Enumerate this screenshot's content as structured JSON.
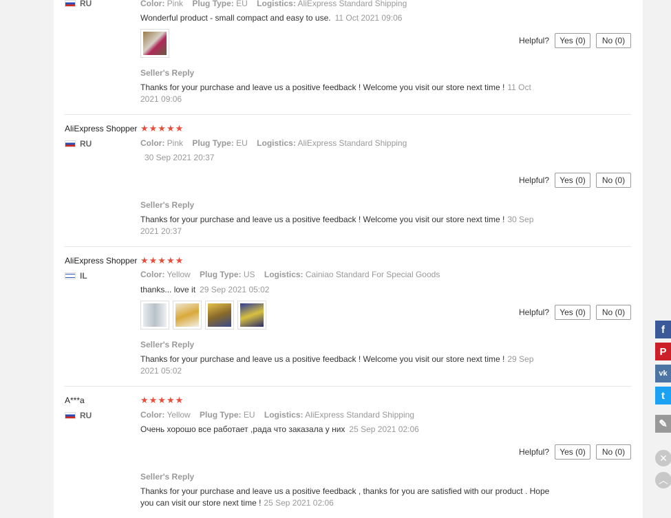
{
  "helpful_label": "Helpful?",
  "seller_reply_label": "Seller's Reply",
  "labels": {
    "color": "Color:",
    "plug": "Plug Type:",
    "logistics": "Logistics:"
  },
  "stars": "★★★★★",
  "reviews": [
    {
      "name": "",
      "country": "RU",
      "color": "Pink",
      "plug": "EU",
      "logistics": "AliExpress Standard Shipping",
      "text": "Wonderful product - small compact and easy to use.",
      "date": "11 Oct 2021 09:06",
      "yes": "Yes (0)",
      "no": "No (0)",
      "reply": "Thanks for your purchase and leave us a positive feedback ! Welcome you visit our store next time !",
      "reply_date": "11 Oct 2021 09:06"
    },
    {
      "name": "AliExpress Shopper",
      "country": "RU",
      "color": "Pink",
      "plug": "EU",
      "logistics": "AliExpress Standard Shipping",
      "text": "",
      "date": "30 Sep 2021 20:37",
      "yes": "Yes (0)",
      "no": "No (0)",
      "reply": "Thanks for your purchase and leave us a positive feedback ! Welcome you visit our store next time !",
      "reply_date": "30 Sep 2021 20:37"
    },
    {
      "name": "AliExpress Shopper",
      "country": "IL",
      "color": "Yellow",
      "plug": "US",
      "logistics": "Cainiao Standard For Special Goods",
      "text": "thanks... love it",
      "date": "29 Sep 2021 05:02",
      "yes": "Yes (0)",
      "no": "No (0)",
      "reply": "Thanks for your purchase and leave us a positive feedback ! Welcome you visit our store next time !",
      "reply_date": "29 Sep 2021 05:02"
    },
    {
      "name": "A***a",
      "country": "RU",
      "color": "Yellow",
      "plug": "EU",
      "logistics": "AliExpress Standard Shipping",
      "text": "Очень хорошо все работает ,рада что заказала у них",
      "date": "25 Sep 2021 02:06",
      "yes": "Yes (0)",
      "no": "No (0)",
      "reply": "Thanks for your purchase and leave us a positive feedback , thanks for you are satisfied with our product . Hope you can visit our store next time !",
      "reply_date": "25 Sep 2021 02:06"
    }
  ],
  "social": [
    {
      "icon": "facebook-icon",
      "glyph": "f",
      "color": "#3b5998"
    },
    {
      "icon": "pinterest-icon",
      "glyph": "P",
      "color": "#cb2027"
    },
    {
      "icon": "vk-icon",
      "glyph": "vk",
      "color": "#4c75a3"
    },
    {
      "icon": "twitter-icon",
      "glyph": "t",
      "color": "#1da1f2"
    },
    {
      "icon": "edit-icon",
      "glyph": "✎",
      "color": "#999999"
    }
  ],
  "close_glyph": "✕",
  "top_glyph": "︿"
}
